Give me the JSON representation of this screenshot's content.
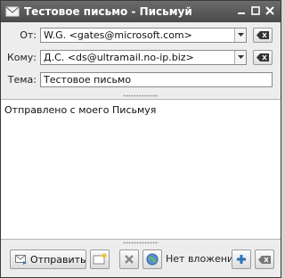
{
  "window": {
    "title": "Тестовое письмо - Письмуй",
    "controls": [
      "minimize",
      "maximize",
      "close"
    ]
  },
  "header": {
    "from_label": "От:",
    "from_value": "W.G. <gates@microsoft.com>",
    "to_label": "Кому:",
    "to_value": "Д.С. <ds@ultramail.no-ip.biz>",
    "subject_label": "Тема:",
    "subject_value": "Тестовое письмо"
  },
  "body": {
    "text": "Отправлено с моего Письмуя"
  },
  "bottom": {
    "send_label": "Отправить",
    "attachments_label": "Нет вложений"
  },
  "colors": {
    "titlebar": "#555555",
    "accent_blue": "#2f6fb8",
    "window_bg": "#ededed"
  }
}
